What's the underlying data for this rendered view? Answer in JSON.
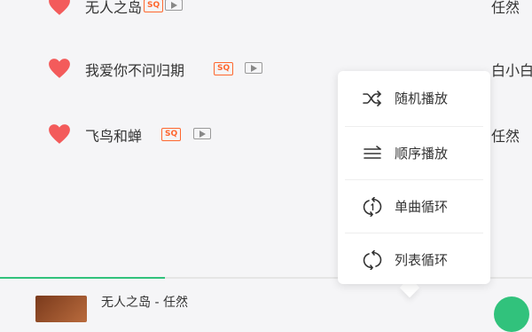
{
  "songs": [
    {
      "title": "无人之岛",
      "badge": "SQ",
      "artist": "任然",
      "liked": true
    },
    {
      "title": "我爱你不问归期",
      "badge": "SQ",
      "artist": "白小白",
      "liked": true
    },
    {
      "title": "飞鸟和蝉",
      "badge": "SQ",
      "artist": "任然",
      "liked": true
    }
  ],
  "play_mode_menu": {
    "items": [
      {
        "label": "随机播放",
        "icon": "shuffle-icon"
      },
      {
        "label": "顺序播放",
        "icon": "sequence-icon"
      },
      {
        "label": "单曲循环",
        "icon": "repeat-one-icon"
      },
      {
        "label": "列表循环",
        "icon": "repeat-list-icon"
      }
    ]
  },
  "player": {
    "now_playing": "无人之岛 - 任然",
    "progress": 0.31
  },
  "colors": {
    "accent_green": "#31c27c",
    "heart_red": "#f35b5b",
    "sq_orange": "#fe672e"
  }
}
